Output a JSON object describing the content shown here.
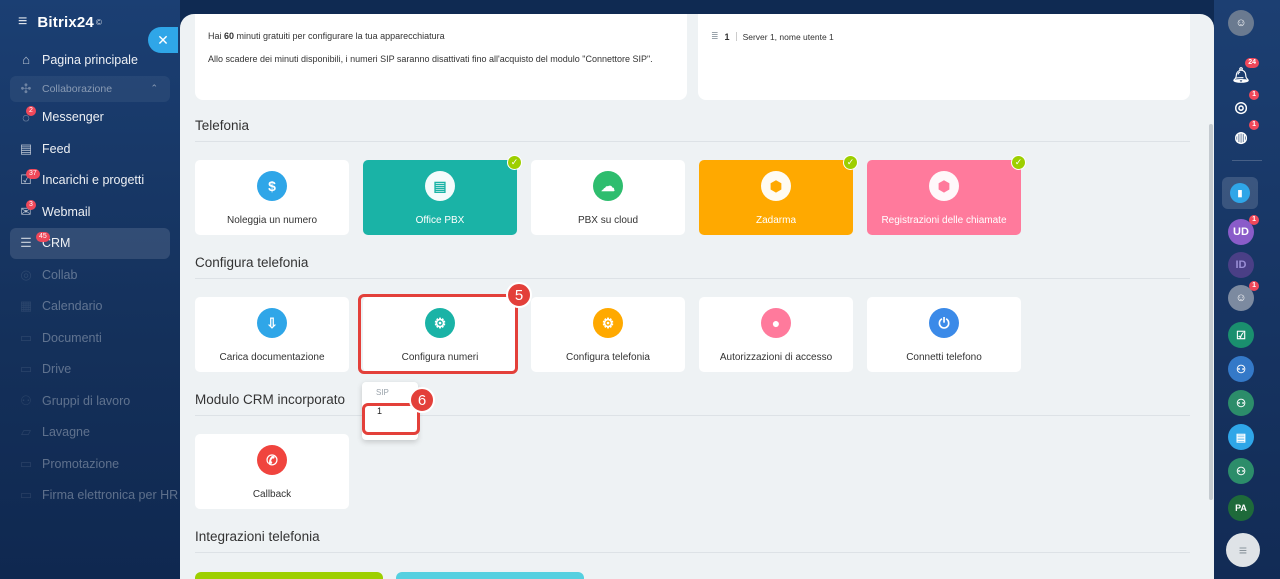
{
  "sidebar": {
    "brand": "Bitrix24",
    "brand_mark": "©",
    "items": [
      {
        "label": "Pagina principale",
        "icon": "home-icon",
        "glyph": "⌂"
      },
      {
        "label": "Collaborazione",
        "icon": "collab-icon",
        "glyph": "✣"
      },
      {
        "label": "Messenger",
        "icon": "chat-icon",
        "glyph": "◌",
        "badge": "2"
      },
      {
        "label": "Feed",
        "icon": "feed-icon",
        "glyph": "▤"
      },
      {
        "label": "Incarichi e progetti",
        "icon": "tasks-icon",
        "glyph": "☑",
        "badge": "37"
      },
      {
        "label": "Webmail",
        "icon": "mail-icon",
        "glyph": "✉",
        "badge": "3"
      },
      {
        "label": "CRM",
        "icon": "crm-icon",
        "glyph": "☰",
        "badge": "45"
      },
      {
        "label": "Collab",
        "icon": "collab2-icon",
        "glyph": "◎"
      },
      {
        "label": "Calendario",
        "icon": "calendar-icon",
        "glyph": "▦"
      },
      {
        "label": "Documenti",
        "icon": "docs-icon",
        "glyph": "▭"
      },
      {
        "label": "Drive",
        "icon": "drive-icon",
        "glyph": "▭"
      },
      {
        "label": "Gruppi di lavoro",
        "icon": "groups-icon",
        "glyph": "⚇"
      },
      {
        "label": "Lavagne",
        "icon": "boards-icon",
        "glyph": "▱"
      },
      {
        "label": "Promotazione",
        "icon": "promo-icon",
        "glyph": "▭"
      },
      {
        "label": "Firma elettronica per HR",
        "icon": "sign-icon",
        "glyph": "▭"
      }
    ]
  },
  "top_info": {
    "line1_pre": "Hai ",
    "line1_bold": "60",
    "line1_post": " minuti gratuiti per configurare la tua apparecchiatura",
    "line2": "Allo scadere dei minuti disponibili, i numeri SIP saranno disattivati fino all'acquisto del modulo \"Connettore SIP\".",
    "server_count": "1",
    "server_text": "Server 1, nome utente 1"
  },
  "sections": {
    "telefonia": "Telefonia",
    "configura": "Configura telefonia",
    "modulo": "Modulo CRM incorporato",
    "integrazioni": "Integrazioni telefonia"
  },
  "telefonia_tiles": [
    {
      "label": "Noleggia un numero",
      "icon": "coin-icon",
      "glyph": "$",
      "color": "#2fa6e8",
      "filled": false,
      "checked": false
    },
    {
      "label": "Office PBX",
      "icon": "pbx-icon",
      "glyph": "▤",
      "color": "#1ab3a6",
      "filled": true,
      "checked": true
    },
    {
      "label": "PBX su cloud",
      "icon": "cloud-pbx-icon",
      "glyph": "☁",
      "color": "#2ebd6e",
      "filled": false,
      "checked": false
    },
    {
      "label": "Zadarma",
      "icon": "box-icon",
      "glyph": "⬢",
      "color": "#ffa900",
      "filled": true,
      "checked": true
    },
    {
      "label": "Registrazioni delle chiamate",
      "icon": "box-icon",
      "glyph": "⬢",
      "color": "#ff7a9c",
      "filled": true,
      "checked": true
    }
  ],
  "configura_tiles": [
    {
      "label": "Carica documentazione",
      "icon": "upload-doc-icon",
      "glyph": "⇩",
      "color": "#2fa6e8"
    },
    {
      "label": "Configura numeri",
      "icon": "phone-gear-icon",
      "glyph": "⚙",
      "color": "#1ab3a6"
    },
    {
      "label": "Configura telefonia",
      "icon": "settings-icon",
      "glyph": "⚙",
      "color": "#ffa900"
    },
    {
      "label": "Autorizzazioni di accesso",
      "icon": "lock-user-icon",
      "glyph": "●",
      "color": "#ff7a9c"
    },
    {
      "label": "Connetti telefono",
      "icon": "plug-icon",
      "glyph": "⏻",
      "color": "#3b8ae8"
    }
  ],
  "modulo_tiles": [
    {
      "label": "Callback",
      "icon": "callback-icon",
      "glyph": "✆",
      "color": "#f0443e"
    }
  ],
  "steps": {
    "a": "5",
    "b": "6"
  },
  "dropdown": {
    "header": "SIP",
    "option": "1"
  },
  "rightbar": {
    "notif_badge": "24",
    "badge1": "1",
    "badge2": "1",
    "ud": "UD",
    "ud_badge": "1",
    "id": "ID",
    "avatar_badge": "1",
    "pa": "PA"
  },
  "colors": {
    "accent": "#2fa6e8",
    "highlight": "#e3403a",
    "check": "#9dcf00"
  }
}
